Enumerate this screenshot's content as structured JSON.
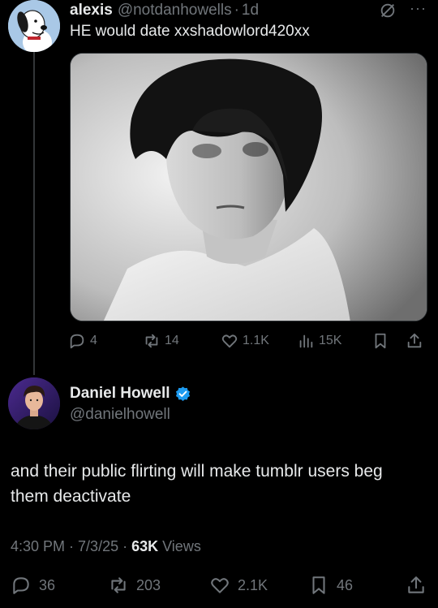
{
  "parent_tweet": {
    "display_name": "alexis",
    "handle": "@notdanhowells",
    "separator": "·",
    "time": "1d",
    "more": "···",
    "text": "HE would date xxshadowlord420xx",
    "media_icon": "photo-portrait",
    "actions": {
      "replies": "4",
      "reposts": "14",
      "likes": "1.1K",
      "views": "15K"
    }
  },
  "main_tweet": {
    "display_name": "Daniel Howell",
    "verified": true,
    "handle": "@danielhowell",
    "text": "and their public flirting will make tumblr users beg them deactivate",
    "time": "4:30 PM",
    "sep1": " · ",
    "date": "7/3/25",
    "sep2": " · ",
    "views_count": "63K",
    "views_label": " Views",
    "actions": {
      "replies": "36",
      "reposts": "203",
      "likes": "2.1K",
      "bookmarks": "46"
    }
  },
  "colors": {
    "background": "#000000",
    "text": "#e7e9ea",
    "muted": "#71767b",
    "verified": "#1d9bf0",
    "thread_line": "#333639"
  }
}
